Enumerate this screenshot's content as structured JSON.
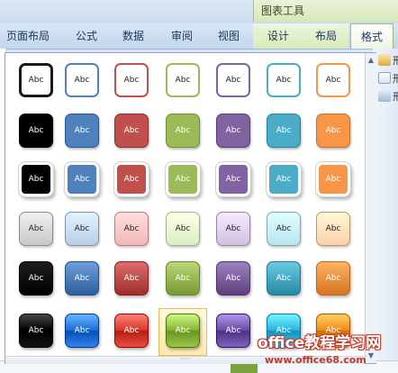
{
  "ribbon": {
    "context_label": "图表工具",
    "tabs": [
      {
        "label": "页面布局"
      },
      {
        "label": "公式"
      },
      {
        "label": "数据"
      },
      {
        "label": "审阅"
      },
      {
        "label": "视图"
      },
      {
        "label": "设计"
      },
      {
        "label": "布局"
      },
      {
        "label": "格式"
      }
    ],
    "right_panel_items": [
      {
        "label": "形",
        "icon": "shape-fill-icon"
      },
      {
        "label": "形",
        "icon": "shape-outline-icon"
      },
      {
        "label": "形",
        "icon": "shape-effects-icon"
      }
    ]
  },
  "gallery": {
    "tile_label": "Abc",
    "rows": [
      {
        "style": "outline",
        "colors": [
          "#1a1a1a",
          "#4f81bd",
          "#c0504d",
          "#9bbb59",
          "#8064a2",
          "#4bacc6",
          "#f79646"
        ]
      },
      {
        "style": "solid",
        "colors": [
          "#000000",
          "#4f81bd",
          "#c0504d",
          "#9bbb59",
          "#8064a2",
          "#4bacc6",
          "#f79646"
        ]
      },
      {
        "style": "solid-white-border",
        "colors": [
          "#000000",
          "#4f81bd",
          "#c0504d",
          "#9bbb59",
          "#8064a2",
          "#4bacc6",
          "#f79646"
        ]
      },
      {
        "style": "light-gradient",
        "colors": [
          "#c8c8c8",
          "#b9cde8",
          "#f2b8b6",
          "#dbeec3",
          "#cfc2e0",
          "#b8e4ef",
          "#fcd0ac"
        ]
      },
      {
        "style": "gradient",
        "colors": [
          "#000000",
          "#4f81bd",
          "#c0504d",
          "#9bbb59",
          "#8064a2",
          "#4bacc6",
          "#f79646"
        ]
      },
      {
        "style": "glossy",
        "colors": [
          "#000000",
          "#1f6fd6",
          "#d43a2f",
          "#86b43b",
          "#6b4ea5",
          "#2db2dc",
          "#f28b1d"
        ]
      }
    ],
    "selected": {
      "row": 5,
      "col": 3
    }
  },
  "watermark": {
    "line1": "office教程学习网",
    "line2": "www.office68.com"
  }
}
